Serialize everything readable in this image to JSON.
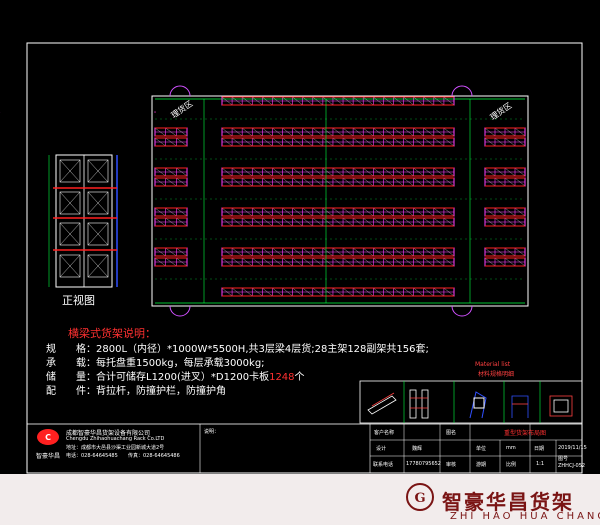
{
  "zones": {
    "left": "理货区",
    "right": "理货区"
  },
  "front_view_label": "正视图",
  "spec": {
    "title": "横梁式货架说明：",
    "lines": [
      {
        "label": "规　　格：",
        "text": "2800L（内径）*1000W*5500H,共3层梁4层货;28主架128副架共156套;"
      },
      {
        "label": "承　　载：",
        "text": "每托盘重1500kg，每层承载3000kg;"
      },
      {
        "label": "储　　量：",
        "text": "合计可储存L1200(进叉）*D1200卡板",
        "highlight": "1248",
        "suffix": "个"
      },
      {
        "label": "配　　件：",
        "text": "背拉杆，防撞护栏，防撞护角"
      }
    ]
  },
  "materials": {
    "title": "Material list",
    "subtitle": "材料规格明细"
  },
  "company": {
    "name_cn": "成都智豪华昌货架设备有限公司",
    "name_en": "Chengdu Zhihaohuachang Rack Co.LTD",
    "address": "地址：成都市大邑县沙渠工业园新城大道2号",
    "tel": "电话：028-64645485",
    "fax": "传真：028-64645486",
    "logo_text": "智豪华昌"
  },
  "titleblock": {
    "note_label": "说明：",
    "row1": [
      "客户名称",
      "",
      "图名",
      "",
      "重型货架布局图"
    ],
    "row2": [
      "设计",
      "魏辉",
      "",
      "单位",
      "mm",
      "日期",
      "2019/11/15"
    ],
    "row3": [
      "联系电话",
      "17780795652",
      "审核",
      "游期",
      "比例",
      "1:1",
      "图号",
      "ZHHCJ-052"
    ]
  },
  "banner": {
    "cn": "智豪华昌货架",
    "en": "ZHI HAO HUA CHANG S"
  },
  "colors": {
    "rack": "#ff40ff",
    "beam": "#ff2020",
    "frame": "#ffffff",
    "accent_green": "#00ff40",
    "accent_blue": "#3050ff",
    "door": "#d050ff"
  }
}
